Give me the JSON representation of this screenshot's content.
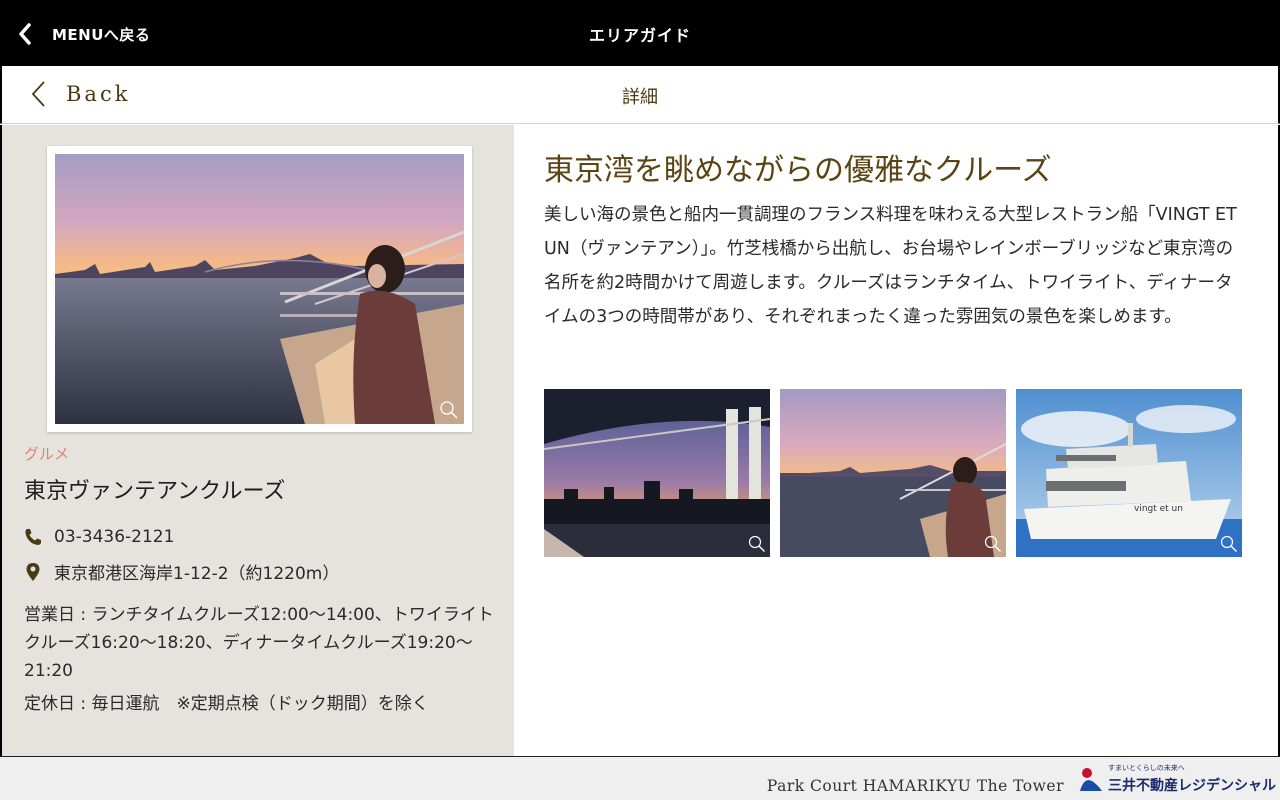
{
  "topbar": {
    "back_menu_label": "MENUへ戻る",
    "title": "エリアガイド"
  },
  "subbar": {
    "back_label": "Back",
    "title": "詳細"
  },
  "spot": {
    "category": "グルメ",
    "name": "東京ヴァンテアンクルーズ",
    "phone": "03-3436-2121",
    "address": "東京都港区海岸1-12-2（約1220m）",
    "hours": "営業日 : ランチタイムクルーズ12:00〜14:00、トワイライトクルーズ16:20〜18:20、ディナータイムクルーズ19:20〜21:20",
    "closed": "定休日 : 毎日運航　※定期点検（ドック期間）を除く"
  },
  "article": {
    "headline": "東京湾を眺めながらの優雅なクルーズ",
    "body": "美しい海の景色と船内一貫調理のフランス料理を味わえる大型レストラン船「VINGT ET UN（ヴァンテアン）」。竹芝桟橋から出航し、お台場やレインボーブリッジなど東京湾の名所を約2時間かけて周遊します。クルーズはランチタイム、トワイライト、ディナータイムの3つの時間帯があり、それぞれまったく違った雰囲気の景色を楽しめます。"
  },
  "gallery": {
    "ship_name": "vingt et un"
  },
  "footer": {
    "brand": "Park Court HAMARIKYU The Tower",
    "logo_tagline": "すまいとくらしの未来へ",
    "logo_text": "三井不動産レジデンシャル"
  },
  "icons": {
    "back": "chevron-left-icon",
    "phone": "phone-icon",
    "location": "map-pin-icon",
    "zoom": "magnifier-icon"
  },
  "colors": {
    "accent_brown": "#5a4414",
    "category": "#e3836a",
    "panel_bg": "#e6e3df"
  }
}
